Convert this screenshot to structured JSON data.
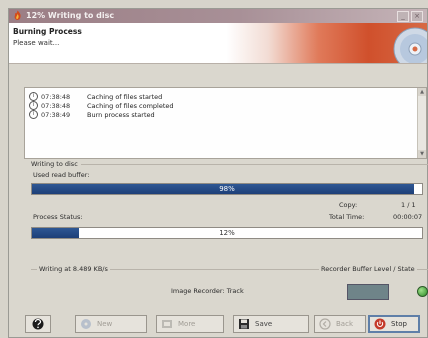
{
  "window": {
    "title": "12% Writing to disc",
    "min_glyph": "_",
    "close_glyph": "×"
  },
  "header": {
    "title": "Burning Process",
    "subtitle": "Please wait..."
  },
  "log": {
    "rows": [
      {
        "icon": "info",
        "time": "07:38:48",
        "message": "Caching of files started"
      },
      {
        "icon": "info",
        "time": "07:38:48",
        "message": "Caching of files completed"
      },
      {
        "icon": "info",
        "time": "07:38:49",
        "message": "Burn process started"
      }
    ]
  },
  "writing": {
    "group_label": "Writing to disc",
    "buffer_label": "Used read buffer:",
    "buffer_percent": 98,
    "buffer_text": "98%",
    "copy_label": "Copy:",
    "copy_value": "1 / 1",
    "total_time_label": "Total Time:",
    "total_time_value": "00:00:07",
    "process_label": "Process Status:",
    "process_percent": 12,
    "process_text": "12%"
  },
  "status": {
    "speed_text": "Writing at 8.489 KB/s",
    "recorder_text": "Image Recorder:   Track",
    "buffer_level_label": "Recorder Buffer Level / State",
    "led_color": "#2b8b26"
  },
  "buttons": {
    "help_icon": "help-icon",
    "new": "New",
    "more": "More",
    "save": "Save",
    "back": "Back",
    "stop": "Stop"
  }
}
